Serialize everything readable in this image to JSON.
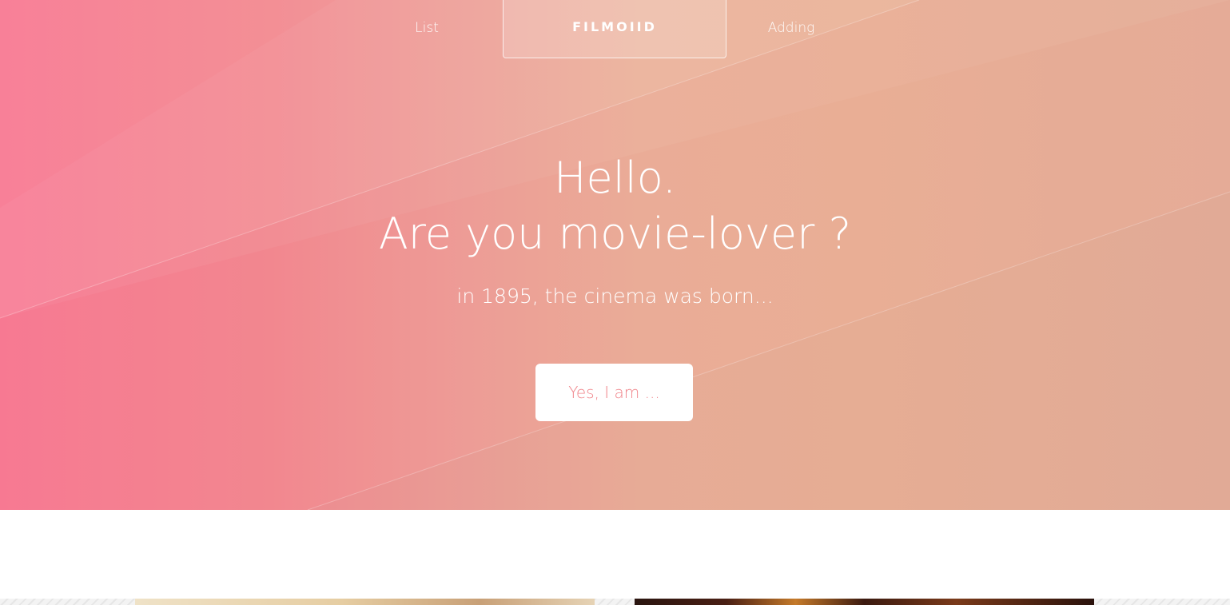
{
  "nav": {
    "list_label": "List",
    "brand": "FILMOIID",
    "adding_label": "Adding"
  },
  "hero": {
    "headline_line1": "Hello.",
    "headline_line2": "Are you movie-lover ?",
    "tagline": "in 1895, the cinema was born...",
    "cta_label": "Yes, I am ..."
  },
  "colors": {
    "hero_left": "#f87a93",
    "hero_right": "#e5ae98",
    "cta_text": "#f0848a",
    "text": "#ffffff"
  }
}
